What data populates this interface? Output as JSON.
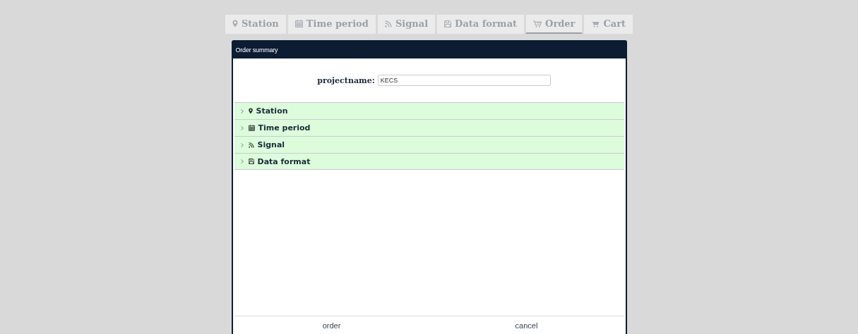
{
  "tabs": [
    {
      "label": "Station",
      "kind": "station",
      "selected": false
    },
    {
      "label": "Time period",
      "kind": "time",
      "selected": false
    },
    {
      "label": "Signal",
      "kind": "signal",
      "selected": false
    },
    {
      "label": "Data format",
      "kind": "format",
      "selected": false
    },
    {
      "label": "Order",
      "kind": "order",
      "selected": true
    },
    {
      "label": "Cart",
      "kind": "cart",
      "selected": false
    }
  ],
  "dialog": {
    "title": "Order summary",
    "project": {
      "label": "projectname:",
      "value": "KECS"
    },
    "sections": [
      {
        "label": "Station",
        "kind": "station",
        "expanded": false
      },
      {
        "label": "Time period",
        "kind": "time",
        "expanded": false
      },
      {
        "label": "Signal",
        "kind": "signal",
        "expanded": false
      },
      {
        "label": "Data format",
        "kind": "format",
        "expanded": false
      }
    ],
    "buttons": [
      "order",
      "cancel"
    ]
  }
}
